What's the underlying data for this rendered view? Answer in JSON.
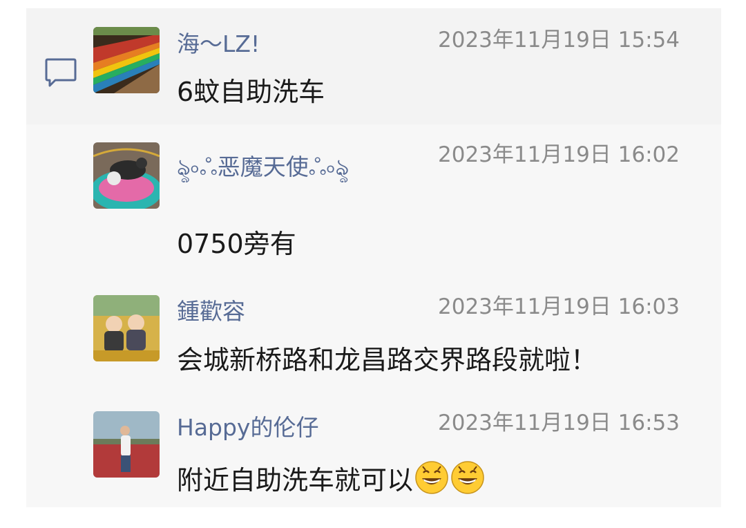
{
  "comments": [
    {
      "name": "海～LZ!",
      "time": "2023年11月19日 15:54",
      "text": "6蚊自助洗车"
    },
    {
      "name": "ৡ৹ஃ恶魔天使ஃ৹ৡ",
      "time": "2023年11月19日 16:02",
      "text": "0750旁有"
    },
    {
      "name": "鍾歡容",
      "time": "2023年11月19日 16:03",
      "text": "会城新桥路和龙昌路交界路段就啦！"
    },
    {
      "name": "Happy的伦仔",
      "time": "2023年11月19日 16:53",
      "text": "附近自助洗车就可以"
    }
  ],
  "icons": {
    "comment": "speech-bubble-icon",
    "emoji": "grinning-face-emoji"
  },
  "colors": {
    "name": "#576b95",
    "time": "#8a8a8a",
    "text": "#1a1a1a",
    "panel": "#f7f7f7"
  }
}
